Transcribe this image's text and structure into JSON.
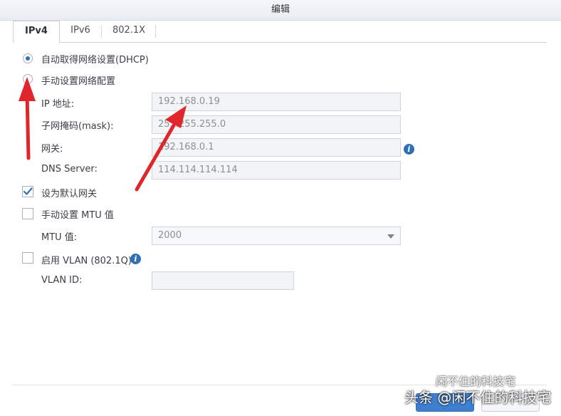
{
  "window": {
    "title": "编辑"
  },
  "tabs": [
    {
      "label": "IPv4",
      "active": true
    },
    {
      "label": "IPv6",
      "active": false
    },
    {
      "label": "802.1X",
      "active": false
    }
  ],
  "ipv4": {
    "dhcp_option": {
      "label": "自动取得网络设置(DHCP)",
      "selected": true
    },
    "manual_option": {
      "label": "手动设置网络配置",
      "selected": false
    },
    "ip_address": {
      "label": "IP 地址:",
      "value": "192.168.0.19"
    },
    "subnet_mask": {
      "label": "子网掩码(mask):",
      "value": "255.255.255.0"
    },
    "gateway": {
      "label": "网关:",
      "value": "192.168.0.1"
    },
    "dns_server": {
      "label": "DNS Server:",
      "value": "114.114.114.114"
    },
    "default_gateway": {
      "label": "设为默认网关",
      "checked": true
    },
    "manual_mtu": {
      "label": "手动设置 MTU 值",
      "checked": false
    },
    "mtu_value": {
      "label": "MTU 值:",
      "selected": "2000"
    },
    "vlan": {
      "label": "启用 VLAN (802.1Q)",
      "checked": false
    },
    "vlan_id": {
      "label": "VLAN ID:",
      "value": ""
    }
  },
  "watermark": {
    "line1": "闲不住的科技宅",
    "line2": "头条 @闲不住的科技宅"
  },
  "colors": {
    "accent": "#2f6fb5",
    "annotation_arrow": "#e0262b",
    "primary_button": "#3f7fd0"
  },
  "icons": {
    "info": "info-circle-icon",
    "checkmark": "checkmark-icon",
    "dropdown": "chevron-down-icon",
    "arrow": "red-arrow-annotation"
  }
}
